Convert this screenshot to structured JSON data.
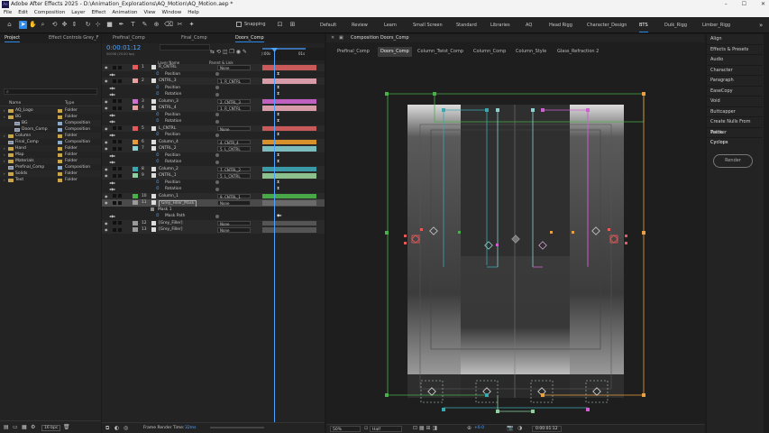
{
  "app": {
    "title": "Adobe After Effects 2025 - D:\\Animation_Explorations\\AQ_Motion\\AQ_Motion.aep *",
    "logo": "Ae",
    "window_controls": [
      "–",
      "☐",
      "✕"
    ]
  },
  "menu": [
    "File",
    "Edit",
    "Composition",
    "Layer",
    "Effect",
    "Animation",
    "View",
    "Window",
    "Help"
  ],
  "toolbar": {
    "snapping_label": "Snapping",
    "workspaces": [
      "Default",
      "Review",
      "Learn",
      "Small Screen",
      "Standard",
      "Libraries",
      "AQ",
      "Head Rigg",
      "Character_Design",
      "BTS",
      "Duik_Rigg",
      "Limber_Rigg"
    ],
    "active_workspace": "BTS",
    "more": "»"
  },
  "project": {
    "tabs": [
      "Project",
      "Effect Controls Grey_F"
    ],
    "search_placeholder": "",
    "columns": [
      "Name",
      "Type"
    ],
    "items": [
      {
        "name": "AQ_Logo",
        "type": "Folder",
        "indent": 0,
        "kind": "folder",
        "label": "#c9a64a"
      },
      {
        "name": "BG",
        "type": "Folder",
        "indent": 0,
        "kind": "folder",
        "label": "#c9a64a"
      },
      {
        "name": "BG",
        "type": "Composition",
        "indent": 1,
        "kind": "comp",
        "label": "#8fa9c9"
      },
      {
        "name": "Doors_Comp",
        "type": "Composition",
        "indent": 1,
        "kind": "comp",
        "label": "#8fa9c9"
      },
      {
        "name": "Column",
        "type": "Folder",
        "indent": 0,
        "kind": "folder",
        "label": "#c9a64a"
      },
      {
        "name": "Final_Comp",
        "type": "Composition",
        "indent": 0,
        "kind": "comp",
        "label": "#8fa9c9"
      },
      {
        "name": "Hand",
        "type": "Folder",
        "indent": 0,
        "kind": "folder",
        "label": "#c9a64a"
      },
      {
        "name": "Map",
        "type": "Folder",
        "indent": 0,
        "kind": "folder",
        "label": "#c9a64a"
      },
      {
        "name": "Materials",
        "type": "Folder",
        "indent": 0,
        "kind": "folder",
        "label": "#c9a64a"
      },
      {
        "name": "Prefinal_Comp",
        "type": "Composition",
        "indent": 0,
        "kind": "comp",
        "label": "#8fa9c9"
      },
      {
        "name": "Solids",
        "type": "Folder",
        "indent": 0,
        "kind": "folder",
        "label": "#c9a64a"
      },
      {
        "name": "Text",
        "type": "Folder",
        "indent": 0,
        "kind": "folder",
        "label": "#c9a64a"
      }
    ],
    "footer_bpc": "16 bpc"
  },
  "timeline": {
    "tabs": [
      "Prefinal_Comp",
      "Final_Comp",
      "Doors_Comp"
    ],
    "active_tab": "Doors_Comp",
    "timecode": "0:00:01:12",
    "fps_info": "00036 (25.00 fps)",
    "col_layer_name": "Layer Name",
    "col_parent": "Parent & Link",
    "ruler_labels": [
      "):00s",
      "01s"
    ],
    "footer_render_label": "Frame Render Time:",
    "footer_render_value": "32ms",
    "layers": [
      {
        "num": "1",
        "name": "R_CNTRL",
        "parent": "None",
        "color": "#e85a5a",
        "bar": "#c85a5a",
        "type": "layer"
      },
      {
        "name": "Position",
        "type": "prop",
        "kf": "⧗"
      },
      {
        "num": "2",
        "name": "CNTRL_3",
        "parent": "1. R_CNTRL",
        "color": "#e8a0a0",
        "bar": "#d89ca8",
        "type": "layer"
      },
      {
        "name": "Position",
        "type": "prop",
        "kf": "⧗"
      },
      {
        "name": "Rotation",
        "type": "prop",
        "kf": "⧗"
      },
      {
        "num": "3",
        "name": "Column_3",
        "parent": "2. CNTRL_3",
        "color": "#d070d0",
        "bar": "#c060c0",
        "type": "layer"
      },
      {
        "num": "4",
        "name": "CNTRL_4",
        "parent": "1. R_CNTRL",
        "color": "#e8a0a0",
        "bar": "#d89ca8",
        "type": "layer"
      },
      {
        "name": "Position",
        "type": "prop",
        "kf": "⧗"
      },
      {
        "name": "Rotation",
        "type": "prop",
        "kf": "⧗"
      },
      {
        "num": "5",
        "name": "L_CNTRL",
        "parent": "None",
        "color": "#e85a5a",
        "bar": "#c85a5a",
        "type": "layer"
      },
      {
        "name": "Position",
        "type": "prop",
        "kf": "⧗"
      },
      {
        "num": "6",
        "name": "Column_4",
        "parent": "4. CNTR_4",
        "color": "#e89a3a",
        "bar": "#d8902a",
        "type": "layer"
      },
      {
        "num": "7",
        "name": "CNTRL_2",
        "parent": "5. L_CNTRL",
        "color": "#8fd0d0",
        "bar": "#7cbcbc",
        "type": "layer"
      },
      {
        "name": "Position",
        "type": "prop",
        "kf": "⧗"
      },
      {
        "name": "Rotation",
        "type": "prop",
        "kf": "⧗"
      },
      {
        "num": "8",
        "name": "Column_2",
        "parent": "7. CNTRL_2",
        "color": "#3aa8b0",
        "bar": "#3a9aa8",
        "type": "layer"
      },
      {
        "num": "9",
        "name": "CNTRL_1",
        "parent": "5. L_CNTRL",
        "color": "#8fd0a0",
        "bar": "#8cc08c",
        "type": "layer"
      },
      {
        "name": "Position",
        "type": "prop",
        "kf": "⧗"
      },
      {
        "name": "Rotation",
        "type": "prop",
        "kf": "⧗"
      },
      {
        "num": "10",
        "name": "Column_1",
        "parent": "9. CNTRL_1",
        "color": "#4ab04a",
        "bar": "#48a848",
        "type": "layer"
      },
      {
        "num": "11",
        "name": "Grey_Filler_Mask",
        "parent": "None",
        "color": "#9a9a9a",
        "bar": "#6a6a6a",
        "type": "layer",
        "selected": true
      },
      {
        "name": "Mask 1",
        "type": "mask"
      },
      {
        "name": "Mask Path",
        "type": "prop",
        "kf": "◆▸"
      },
      {
        "num": "12",
        "name": "[Grey_Filler]",
        "parent": "None",
        "color": "#9a9a9a",
        "bar": "#555555",
        "type": "layer"
      },
      {
        "num": "13",
        "name": "[Grey_Filler]",
        "parent": "None",
        "color": "#9a9a9a",
        "bar": "#555555",
        "type": "layer"
      }
    ]
  },
  "viewer": {
    "panel_title": "Composition Doors_Comp",
    "tabs": [
      "Prefinal_Comp",
      "Doors_Comp",
      "Column_Twist_Comp",
      "Column_Comp",
      "Column_Style",
      "Glass_Refraction 2"
    ],
    "active_tab": "Doors_Comp",
    "zoom": "50%",
    "resolution": "Half",
    "exposure": "+0.0",
    "timecode": "0:00:01:12"
  },
  "right_panel": {
    "items": [
      "Align",
      "Effects & Presets",
      "Audio",
      "Character",
      "Paragraph",
      "EaseCopy",
      "Void",
      "Buttcapper",
      "Create Nulls From Paths",
      "Tracker",
      "Cyclops"
    ],
    "render_button": "Render"
  },
  "colors": {
    "accent": "#2d8ceb",
    "ui_bg": "#232323"
  }
}
